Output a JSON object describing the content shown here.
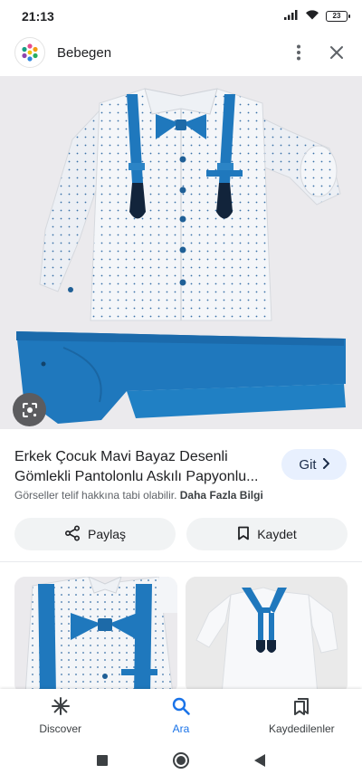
{
  "status_bar": {
    "time": "21:13",
    "battery": "23",
    "icons": [
      "signal-icon",
      "wifi-icon",
      "battery-icon"
    ]
  },
  "header": {
    "site_name": "Bebegen",
    "icons": [
      "site-logo-icon",
      "more-vert-icon",
      "close-icon"
    ]
  },
  "result": {
    "title": "Erkek Çocuk Mavi Bayaz Desenli Gömlekli Pantolonlu Askılı Papyonlu...",
    "visit_label": "Git",
    "copyright_text": "Görseller telif hakkına tabi olabilir.",
    "more_info_label": "Daha Fazla Bilgi"
  },
  "actions": {
    "share_label": "Paylaş",
    "save_label": "Kaydet"
  },
  "bottom_nav": {
    "items": [
      {
        "label": "Discover",
        "icon": "asterisk-icon",
        "active": false
      },
      {
        "label": "Ara",
        "icon": "search-icon",
        "active": true
      },
      {
        "label": "Kaydedilenler",
        "icon": "bookmarks-icon",
        "active": false
      }
    ]
  },
  "system_nav": {
    "icons": [
      "recents-icon",
      "home-icon",
      "back-icon"
    ]
  },
  "colors": {
    "accent": "#1a73e8",
    "product_blue": "#1f78bd",
    "git_button_bg": "#e8f0fe",
    "chip_bg": "#f1f3f4"
  }
}
